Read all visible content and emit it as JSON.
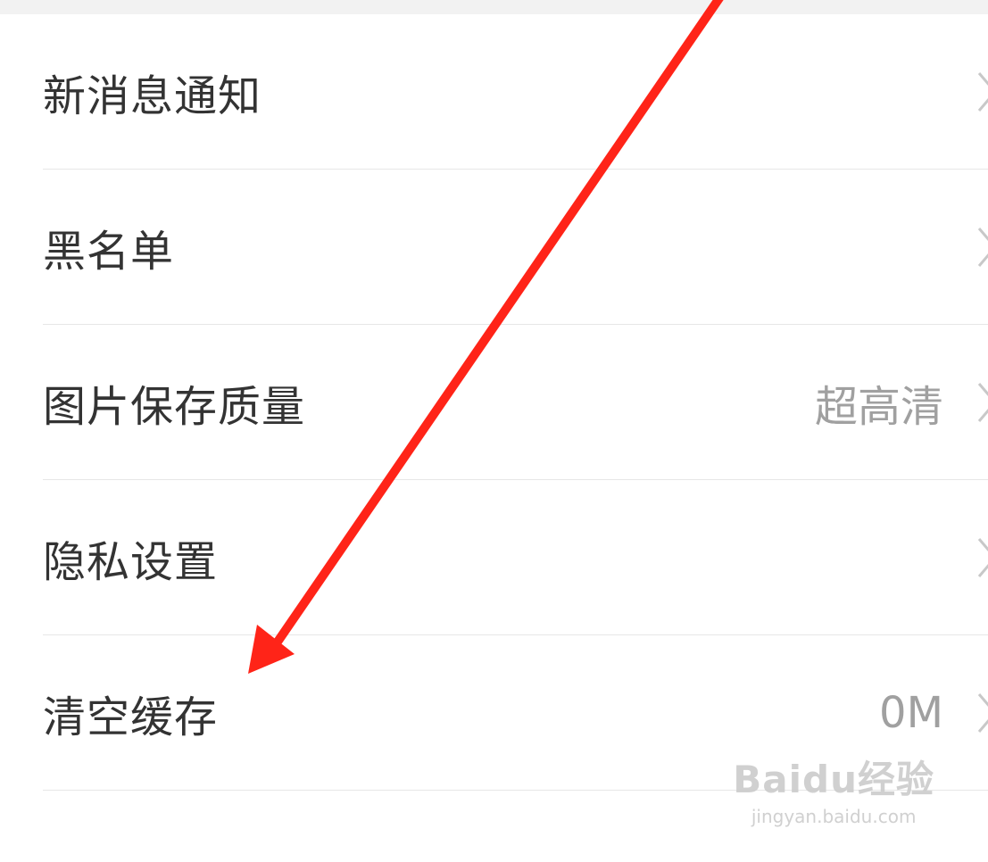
{
  "settings": {
    "items": [
      {
        "label": "新消息通知",
        "value": ""
      },
      {
        "label": "黑名单",
        "value": ""
      },
      {
        "label": "图片保存质量",
        "value": "超高清"
      },
      {
        "label": "隐私设置",
        "value": ""
      },
      {
        "label": "清空缓存",
        "value": "0M"
      }
    ]
  },
  "annotation": {
    "arrow_color": "#ff2418"
  },
  "watermark": {
    "brand": "Baidu经验",
    "url": "jingyan.baidu.com"
  },
  "icons": {
    "row_chevron": "chevron-right-icon"
  }
}
